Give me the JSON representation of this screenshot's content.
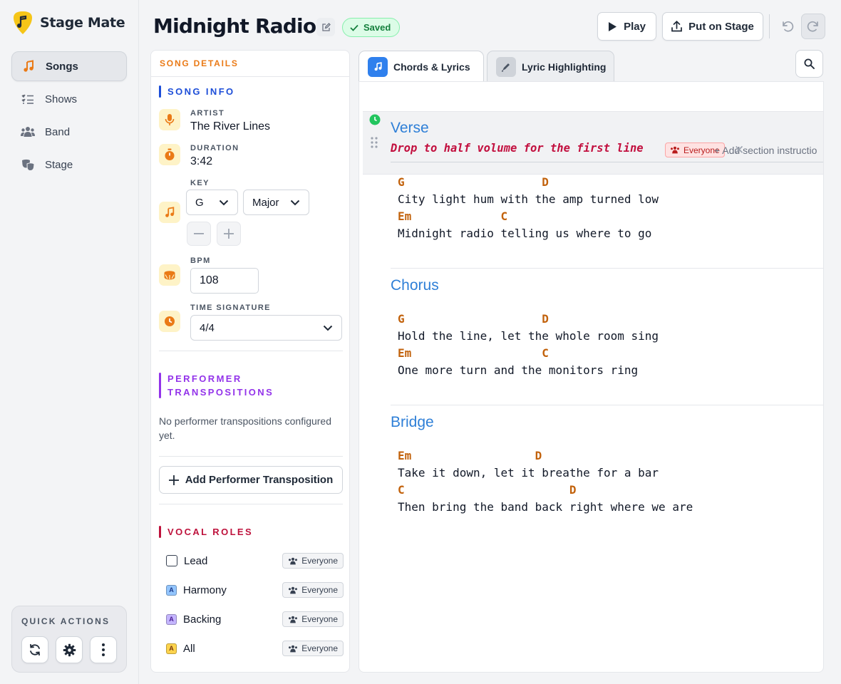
{
  "app": {
    "name": "Stage Mate"
  },
  "nav": [
    {
      "label": "Songs",
      "icon": "music-note-icon",
      "active": true
    },
    {
      "label": "Shows",
      "icon": "list-icon",
      "active": false
    },
    {
      "label": "Band",
      "icon": "people-icon",
      "active": false
    },
    {
      "label": "Stage",
      "icon": "theater-mask-icon",
      "active": false
    }
  ],
  "quick_actions": {
    "title": "QUICK ACTIONS",
    "buttons": [
      "refresh-icon",
      "gear-icon",
      "more-vertical-icon"
    ]
  },
  "header": {
    "title": "Midnight Radio",
    "saved_label": "Saved",
    "play_label": "Play",
    "stage_label": "Put on Stage"
  },
  "details": {
    "header": "SONG DETAILS",
    "song_info_title": "SONG INFO",
    "artist_label": "ARTIST",
    "artist": "The River Lines",
    "duration_label": "DURATION",
    "duration": "3:42",
    "key_label": "KEY",
    "key": "G",
    "mode": "Major",
    "bpm_label": "BPM",
    "bpm": "108",
    "time_sig_label": "TIME SIGNATURE",
    "time_sig": "4/4",
    "performer_title_1": "PERFORMER",
    "performer_title_2": "TRANSPOSITIONS",
    "performer_empty": "No performer transpositions configured yet.",
    "add_performer": "Add Performer Transposition",
    "vocal_roles_title": "VOCAL ROLES",
    "roles": [
      {
        "label": "Lead",
        "badge": "",
        "assignee": "Everyone"
      },
      {
        "label": "Harmony",
        "badge": "A",
        "badge_color": "#93c5fd",
        "assignee": "Everyone"
      },
      {
        "label": "Backing",
        "badge": "A",
        "badge_color": "#c4b5fd",
        "assignee": "Everyone"
      },
      {
        "label": "All",
        "badge": "A",
        "badge_color": "#fcd34d",
        "assignee": "Everyone"
      }
    ]
  },
  "tabs": [
    {
      "label": "Chords & Lyrics",
      "active": true
    },
    {
      "label": "Lyric Highlighting",
      "active": false
    }
  ],
  "editor": {
    "sections": [
      {
        "title": "Verse",
        "instruction": "Drop to half volume for the first line",
        "instruction_assignee": "Everyone",
        "add_instruction": "+ Add section instructio",
        "lines": [
          {
            "chords": "G                    D",
            "lyric": "City light hum with the amp turned low"
          },
          {
            "chords": "Em             C",
            "lyric": "Midnight radio telling us where to go"
          }
        ]
      },
      {
        "title": "Chorus",
        "lines": [
          {
            "chords": "G                    D",
            "lyric": "Hold the line, let the whole room sing"
          },
          {
            "chords": "Em                   C",
            "lyric": "One more turn and the monitors ring"
          }
        ]
      },
      {
        "title": "Bridge",
        "lines": [
          {
            "chords": "Em                  D",
            "lyric": "Take it down, let it breathe for a bar"
          },
          {
            "chords": "C                        D",
            "lyric": "Then bring the band back right where we are"
          }
        ]
      }
    ]
  }
}
